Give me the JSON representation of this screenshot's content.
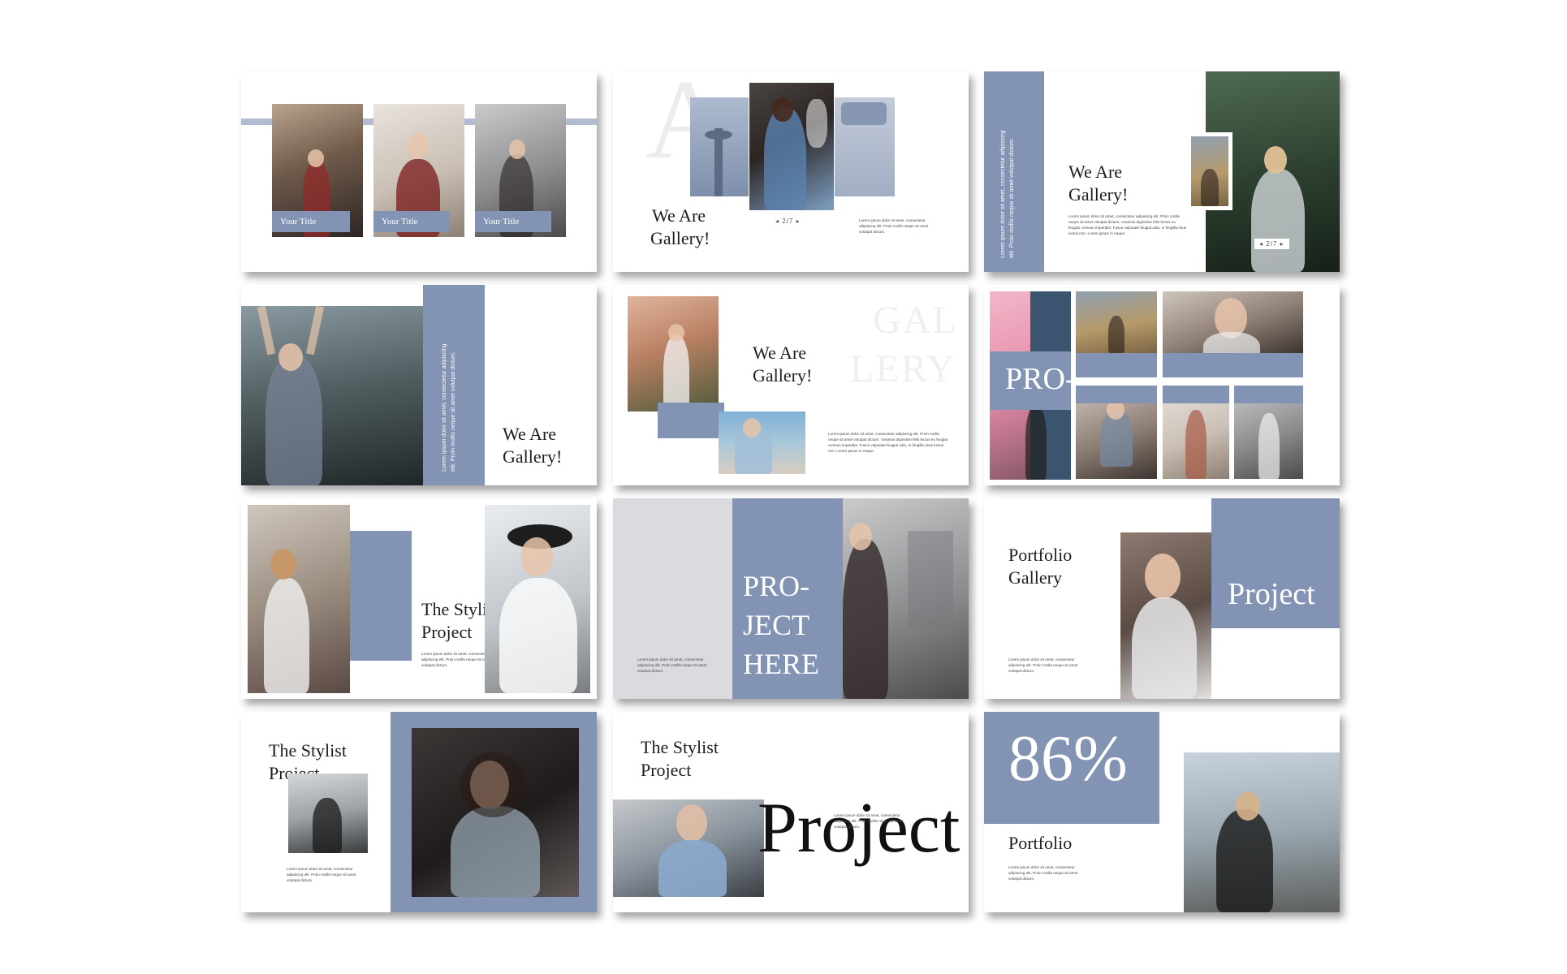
{
  "slides": {
    "s1": {
      "captions": [
        "Your Title",
        "Your Title",
        "Your Title"
      ]
    },
    "s2": {
      "letter": "A",
      "title_l1": "We Are",
      "title_l2": "Gallery!",
      "pager": "◂  2/7  ▸",
      "body": "Lorem ipsum dolor sit amet, consectetur adipiscing elit. Proin mollis neque sit amet volutpat dictum."
    },
    "s3": {
      "vertical": "Lorem ipsum dolor sit amet, consectetur adipiscing elit. Proin mollis neque sit amet volutpat dictum.",
      "title_l1": "We Are",
      "title_l2": "Gallery!",
      "pager": "◂  2/7  ▸",
      "body": "Lorem ipsum dolor sit amet, consectetur adipiscing elit. Proin mollis neque sit amet volutpat dictum. Vivamus dignissim felis lectus eu feugiat. Aenean imperdiet. Fusce vulputate feugiat odio, in fringilla risus luctus non. Lorem ipsum in neque."
    },
    "s4": {
      "vertical": "Lorem ipsum dolor sit amet, consectetur adipiscing elit. Proin mollis neque sit amet volutpat dictum.",
      "title_l1": "We Are",
      "title_l2": "Gallery!"
    },
    "s5": {
      "watermark_l1": "GAL",
      "watermark_l2": "LERY",
      "title_l1": "We Are",
      "title_l2": "Gallery!",
      "body": "Lorem ipsum dolor sit amet, consectetur adipiscing elit. Proin mollis neque sit amet volutpat dictum. Vivamus dignissim felis lectus eu feugiat. Aenean imperdiet. Fusce vulputate feugiat odio, in fringilla risus luctus non. Lorem ipsum in neque."
    },
    "s6": {
      "label": "PRO-"
    },
    "s7": {
      "title_l1": "The Stylist",
      "title_l2": "Project",
      "body": "Lorem ipsum dolor sit amet, consectetur adipiscing elit. Proin mollis neque sit amet volutpat dictum."
    },
    "s8": {
      "big_l1": "PRO-",
      "big_l2": "JECT",
      "big_l3": "HERE",
      "body": "Lorem ipsum dolor sit amet, consectetur adipiscing elit. Proin mollis neque sit amet volutpat dictum."
    },
    "s9": {
      "title_l1": "Portfolio",
      "title_l2": "Gallery",
      "big": "Project",
      "body": "Lorem ipsum dolor sit amet, consectetur adipiscing elit. Proin mollis neque sit amet volutpat dictum."
    },
    "s10": {
      "title_l1": "The Stylist",
      "title_l2": "Project",
      "body": "Lorem ipsum dolor sit amet, consectetur adipiscing elit. Proin mollis neque sit amet volutpat dictum."
    },
    "s11": {
      "title_l1": "The Stylist",
      "title_l2": "Project",
      "big": "Project",
      "body": "Lorem ipsum dolor sit amet, consectetur adipiscing elit. Proin mollis neque sit amet volutpat dictum."
    },
    "s12": {
      "percent": "86%",
      "title": "Portfolio",
      "body": "Lorem ipsum dolor sit amet, consectetur adipiscing elit. Proin mollis neque sit amet volutpat dictum."
    }
  },
  "colors": {
    "accent": "#8393b4",
    "accent_light": "#b1bcd2",
    "panel_grey": "#d9dbdf"
  }
}
